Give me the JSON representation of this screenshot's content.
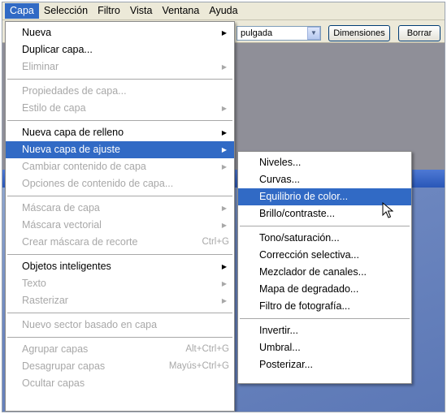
{
  "menubar": {
    "items": [
      "Capa",
      "Selección",
      "Filtro",
      "Vista",
      "Ventana",
      "Ayuda"
    ]
  },
  "options_bar": {
    "units_value": "pulgada",
    "dimensions_button": "Dimensiones",
    "clear_button": "Borrar"
  },
  "main_menu": {
    "items": [
      {
        "label": "Nueva",
        "submenu": true
      },
      {
        "label": "Duplicar capa..."
      },
      {
        "label": "Eliminar",
        "disabled": true,
        "submenu": true
      },
      {
        "label": "Propiedades de capa...",
        "disabled": true
      },
      {
        "label": "Estilo de capa",
        "disabled": true,
        "submenu": true
      },
      {
        "label": "Nueva capa de relleno",
        "submenu": true
      },
      {
        "label": "Nueva capa de ajuste",
        "submenu": true
      },
      {
        "label": "Cambiar contenido de capa",
        "disabled": true,
        "submenu": true
      },
      {
        "label": "Opciones de contenido de capa...",
        "disabled": true
      },
      {
        "label": "Máscara de capa",
        "disabled": true,
        "submenu": true
      },
      {
        "label": "Máscara vectorial",
        "disabled": true,
        "submenu": true
      },
      {
        "label": "Crear máscara de recorte",
        "disabled": true,
        "shortcut": "Ctrl+G"
      },
      {
        "label": "Objetos inteligentes",
        "submenu": true
      },
      {
        "label": "Texto",
        "disabled": true,
        "submenu": true
      },
      {
        "label": "Rasterizar",
        "disabled": true,
        "submenu": true
      },
      {
        "label": "Nuevo sector basado en capa",
        "disabled": true
      },
      {
        "label": "Agrupar capas",
        "disabled": true,
        "shortcut": "Alt+Ctrl+G"
      },
      {
        "label": "Desagrupar capas",
        "disabled": true,
        "shortcut": "Mayús+Ctrl+G"
      },
      {
        "label": "Ocultar capas",
        "disabled": true
      }
    ]
  },
  "adjustment_submenu": {
    "items": [
      {
        "label": "Niveles..."
      },
      {
        "label": "Curvas..."
      },
      {
        "label": "Equilibrio de color..."
      },
      {
        "label": "Brillo/contraste..."
      },
      {
        "label": "Tono/saturación..."
      },
      {
        "label": "Corrección selectiva..."
      },
      {
        "label": "Mezclador de canales..."
      },
      {
        "label": "Mapa de degradado..."
      },
      {
        "label": "Filtro de fotografía..."
      },
      {
        "label": "Invertir..."
      },
      {
        "label": "Umbral..."
      },
      {
        "label": "Posterizar..."
      }
    ]
  },
  "icons": {
    "submenu_arrow": "▶",
    "dropdown_chevron": "▼",
    "cursor": "mouse-pointer-icon"
  },
  "colors": {
    "highlight": "#316ac5",
    "disabled_text": "#a8a8a8",
    "menubar_bg": "#ece9d8"
  }
}
